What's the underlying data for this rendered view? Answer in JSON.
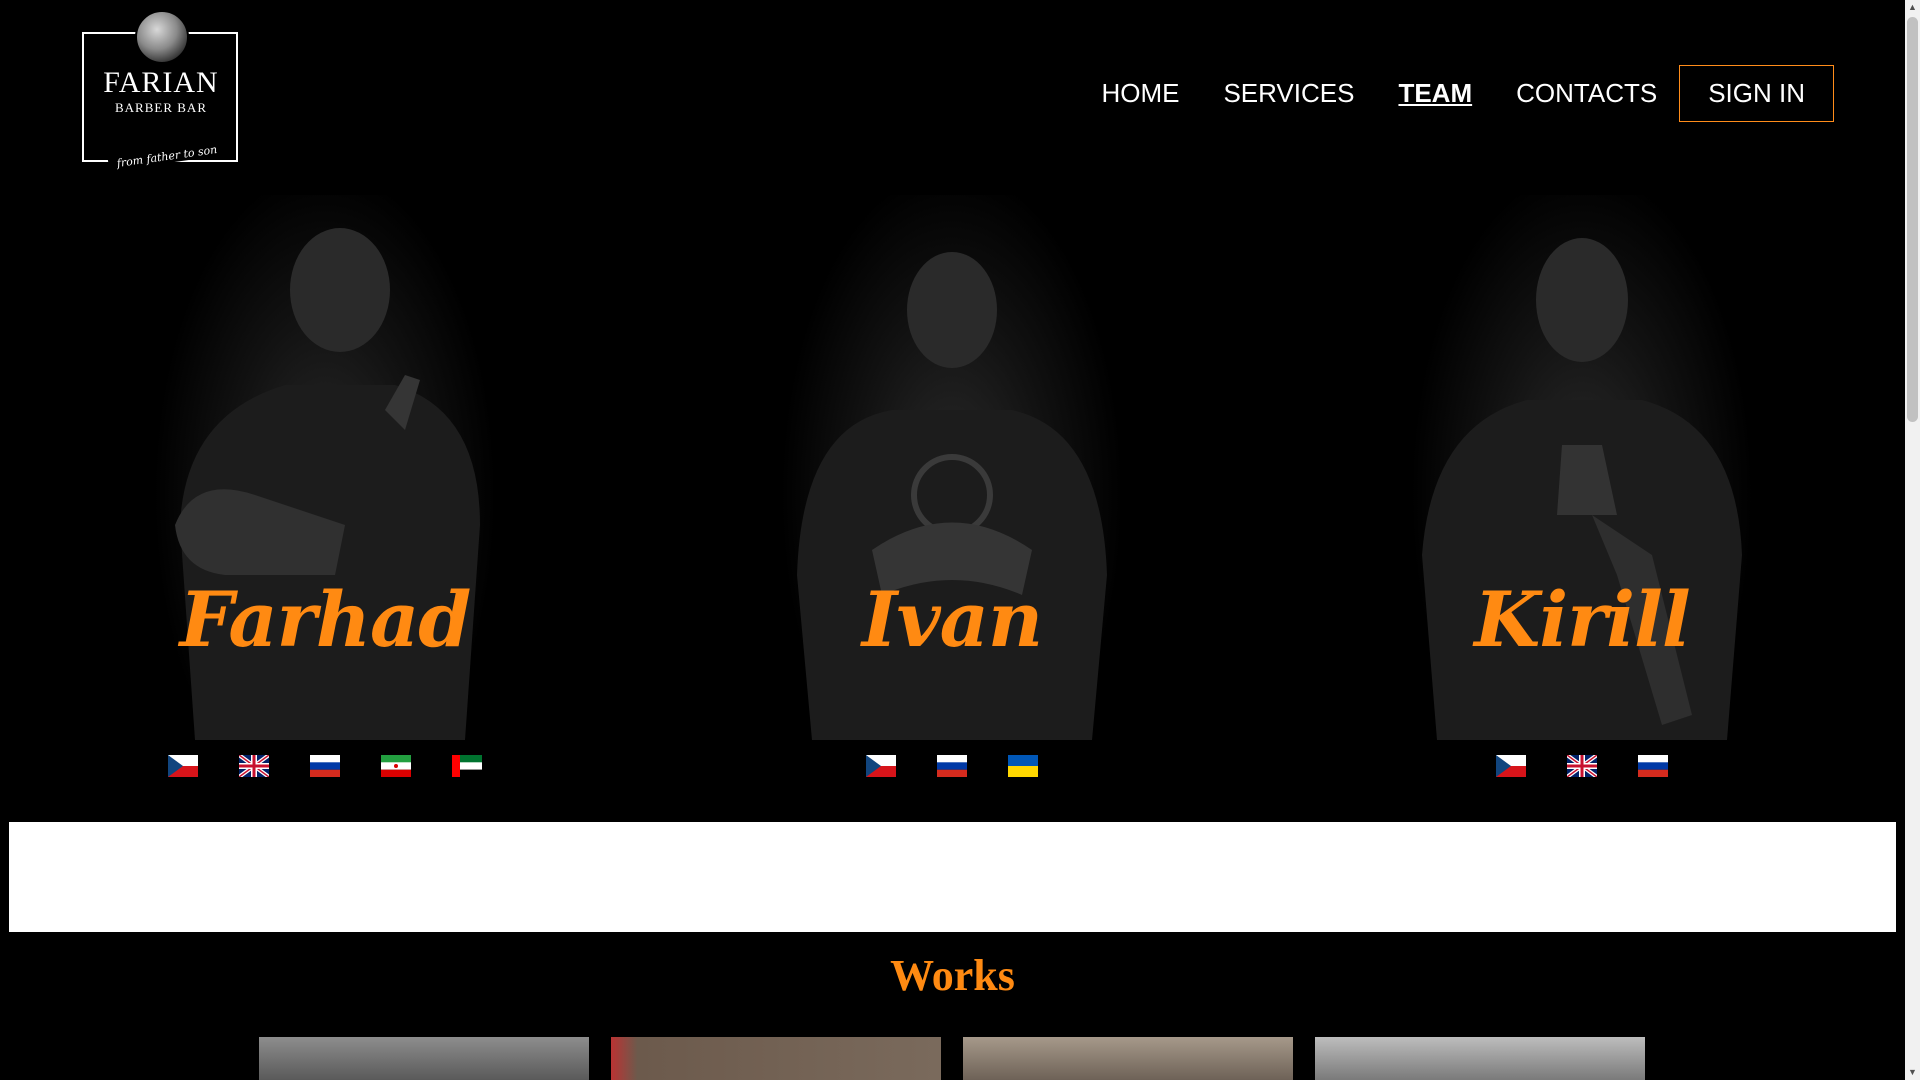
{
  "logo": {
    "name": "FARIAN",
    "subtitle": "BARBER BAR",
    "tagline": "from father to son"
  },
  "nav": {
    "items": [
      "HOME",
      "SERVICES",
      "TEAM",
      "CONTACTS"
    ],
    "active": "TEAM",
    "sign_in": "SIGN IN"
  },
  "team": [
    {
      "name": "Farhad",
      "languages": [
        "Czech",
        "English",
        "Russian",
        "Persian",
        "Arabic"
      ]
    },
    {
      "name": "Ivan",
      "languages": [
        "Czech",
        "Russian",
        "Ukrainian"
      ]
    },
    {
      "name": "Kirill",
      "languages": [
        "Czech",
        "English",
        "Russian"
      ]
    }
  ],
  "works": {
    "title": "Works"
  },
  "colors": {
    "accent": "#ff8a12",
    "background": "#000000",
    "sign_in_border": "#ff8c1a"
  },
  "icons": {
    "flags": [
      "czech-flag-icon",
      "uk-flag-icon",
      "russia-flag-icon",
      "iran-flag-icon",
      "uae-flag-icon",
      "ukraine-flag-icon"
    ],
    "scrollbar": [
      "scroll-up-arrow-icon",
      "scroll-down-arrow-icon"
    ]
  }
}
